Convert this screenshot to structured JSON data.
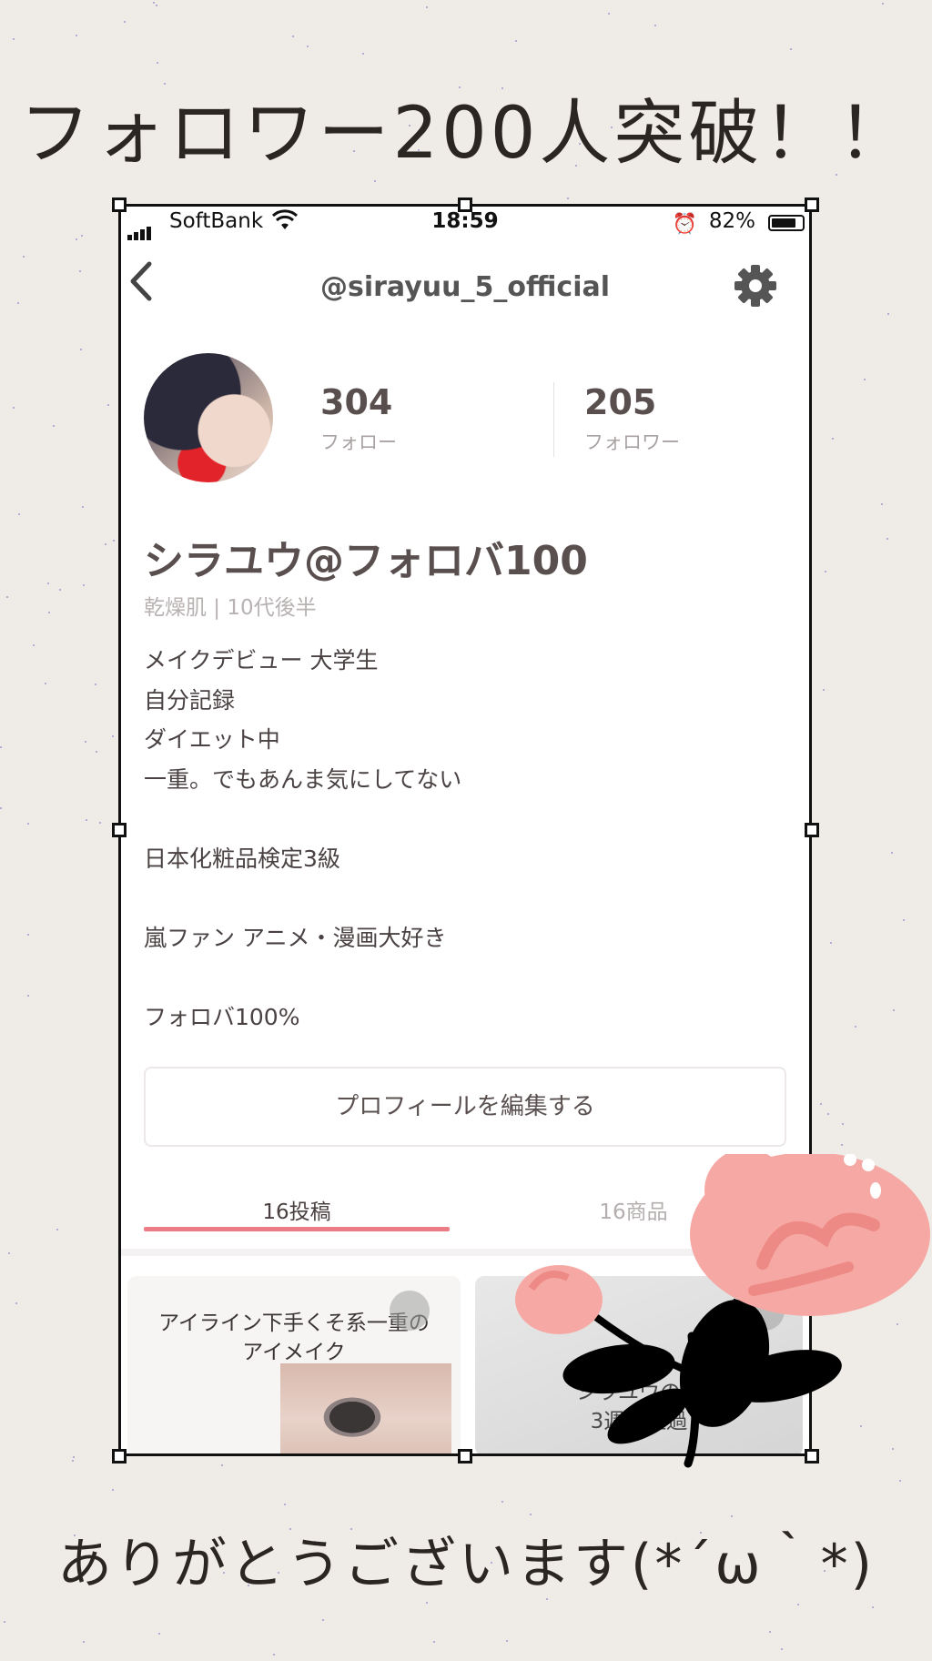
{
  "overlay": {
    "headline": "フォロワー200人突破！！",
    "thanks": "ありがとうございます(*´ω｀*)"
  },
  "status": {
    "carrier": "SoftBank",
    "time": "18:59",
    "battery": "82%",
    "battery_level": 0.82
  },
  "nav": {
    "title": "@sirayuu_5_official"
  },
  "profile": {
    "follow_count": "304",
    "follow_label": "フォロー",
    "follower_count": "205",
    "follower_label": "フォロワー",
    "name": "シラユウ@フォロバ100",
    "skin_info": "乾燥肌 | 10代後半",
    "bio": "メイクデビュー 大学生\n自分記録\nダイエット中\n一重。でもあんま気にしてない\n\n日本化粧品検定3級\n\n嵐ファン  アニメ・漫画大好き\n\nフォロバ100%",
    "edit_button": "プロフィールを編集する"
  },
  "tabs": [
    {
      "label": "16投稿",
      "active": true
    },
    {
      "label": "16商品",
      "active": false
    }
  ],
  "posts": [
    {
      "title": "アイライン下手くそ系一重の\nアイメイク"
    },
    {
      "title": "シラユウのダ\n3週間経過"
    }
  ],
  "colors": {
    "accent": "#ec7d86",
    "flower_pink": "#f6a9a4",
    "background": "#efebe7"
  }
}
